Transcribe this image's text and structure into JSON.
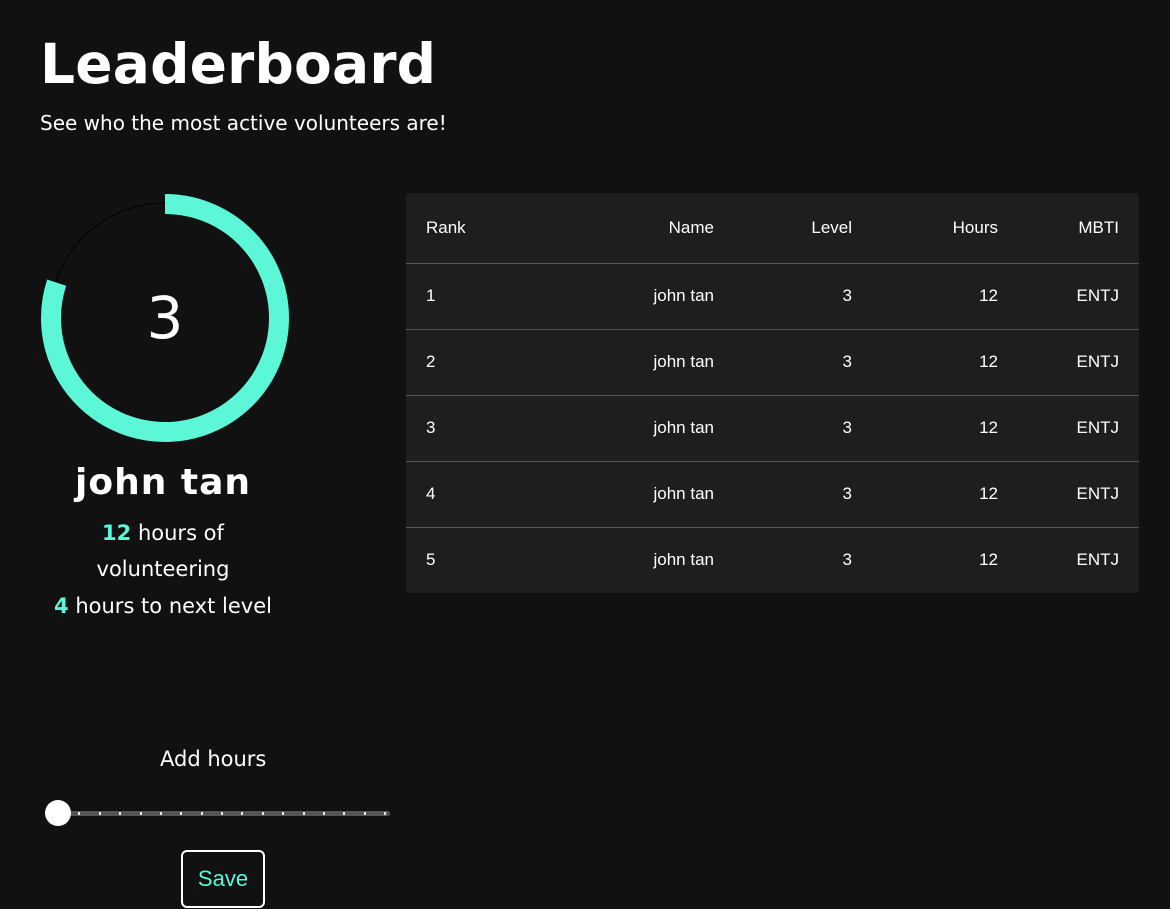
{
  "header": {
    "title": "Leaderboard",
    "subtitle": "See who the most active volunteers are!"
  },
  "profile": {
    "level": "3",
    "name": "john tan",
    "hours_value": "12",
    "hours_text": "hours of volunteering",
    "next_level_value": "4",
    "next_level_text": "hours to next level",
    "level_progress": 0.8
  },
  "add_hours": {
    "label": "Add hours",
    "slider_value": 0,
    "slider_steps": 16,
    "save_label": "Save"
  },
  "table": {
    "columns": [
      "Rank",
      "Name",
      "Level",
      "Hours",
      "MBTI"
    ],
    "rows": [
      [
        "1",
        "john tan",
        "3",
        "12",
        "ENTJ"
      ],
      [
        "2",
        "john tan",
        "3",
        "12",
        "ENTJ"
      ],
      [
        "3",
        "john tan",
        "3",
        "12",
        "ENTJ"
      ],
      [
        "4",
        "john tan",
        "3",
        "12",
        "ENTJ"
      ],
      [
        "5",
        "john tan",
        "3",
        "12",
        "ENTJ"
      ]
    ]
  },
  "colors": {
    "background": "#111111",
    "accent": "#5cf7d6",
    "card": "#1e1e1e",
    "ring_track": "#000000"
  }
}
